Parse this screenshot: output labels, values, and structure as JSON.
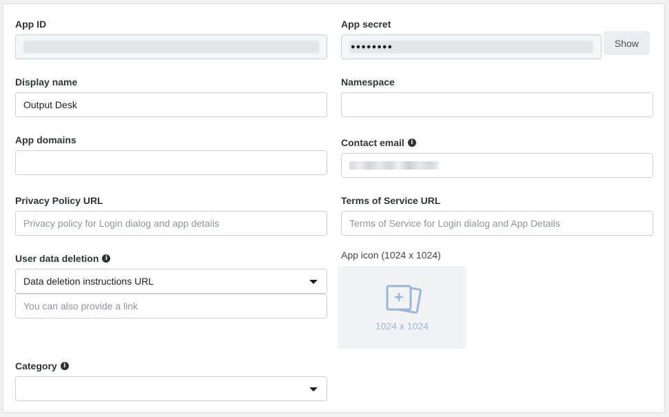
{
  "form": {
    "app_id": {
      "label": "App ID"
    },
    "app_secret": {
      "label": "App secret",
      "masked": "●●●●●●●●",
      "show_label": "Show"
    },
    "display_name": {
      "label": "Display name",
      "value": "Output Desk"
    },
    "namespace": {
      "label": "Namespace",
      "value": ""
    },
    "app_domains": {
      "label": "App domains",
      "value": ""
    },
    "contact_email": {
      "label": "Contact email"
    },
    "privacy_policy": {
      "label": "Privacy Policy URL",
      "placeholder": "Privacy policy for Login dialog and app details"
    },
    "terms_of_service": {
      "label": "Terms of Service URL",
      "placeholder": "Terms of Service for Login dialog and App Details"
    },
    "user_data_deletion": {
      "label": "User data deletion",
      "selected": "Data deletion instructions URL",
      "placeholder": "You can also provide a link"
    },
    "app_icon": {
      "label": "App icon (1024 x 1024)",
      "dimensions": "1024 x 1024"
    },
    "category": {
      "label": "Category",
      "selected": ""
    }
  },
  "icons": {
    "info": "info-icon",
    "dropdown": "chevron-down-icon",
    "image_placeholder": "image-add-icon"
  },
  "colors": {
    "label": "#2f3336",
    "border": "#ccd0d5",
    "placeholder_text": "#90949c",
    "icon_accent": "#9cb4d8"
  }
}
